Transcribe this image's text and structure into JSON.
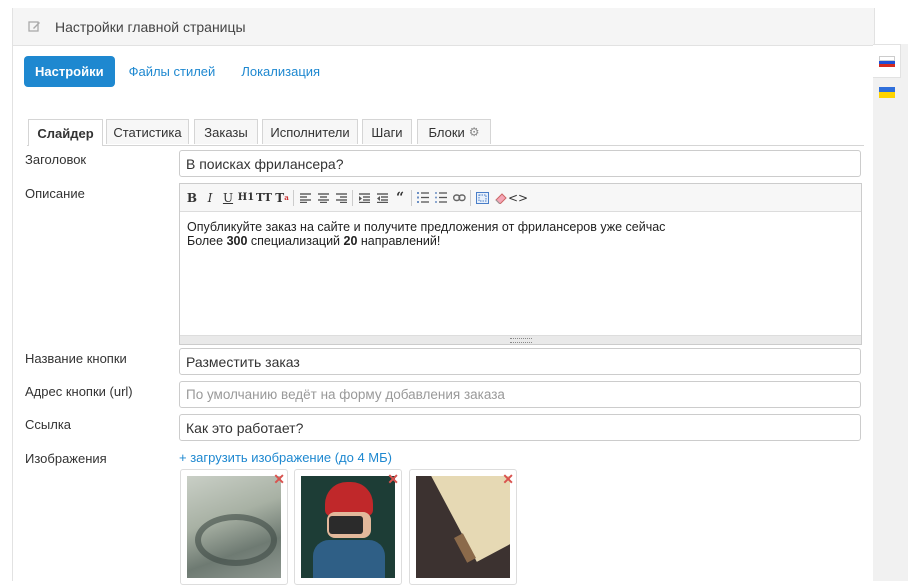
{
  "header": {
    "title": "Настройки главной страницы",
    "icon": "edit-icon"
  },
  "top_tabs": [
    {
      "label": "Настройки",
      "active": true
    },
    {
      "label": "Файлы стилей",
      "active": false
    },
    {
      "label": "Локализация",
      "active": false
    }
  ],
  "languages": [
    {
      "name": "ru",
      "colors": [
        "#ffffff",
        "#1e4fd6",
        "#d52b1e"
      ],
      "active": true
    },
    {
      "name": "ua",
      "colors": [
        "#2f6fdb",
        "#ffd400"
      ],
      "active": false
    }
  ],
  "sub_tabs": [
    {
      "label": "Слайдер",
      "active": true
    },
    {
      "label": "Статистика",
      "active": false
    },
    {
      "label": "Заказы",
      "active": false
    },
    {
      "label": "Исполнители",
      "active": false
    },
    {
      "label": "Шаги",
      "active": false
    },
    {
      "label": "Блоки",
      "active": false,
      "icon": "gear-icon"
    }
  ],
  "form": {
    "title_label": "Заголовок",
    "title_value": "В поисках фрилансера?",
    "description_label": "Описание",
    "description": {
      "line1": "Опубликуйте заказ на сайте и получите предложения от фрилансеров уже сейчас",
      "line2_prefix": "Более ",
      "line2_num1": "300",
      "line2_mid": " специализаций ",
      "line2_num2": "20",
      "line2_suffix": " направлений!"
    },
    "button_name_label": "Название кнопки",
    "button_name_value": "Разместить заказ",
    "button_url_label": "Адрес кнопки (url)",
    "button_url_placeholder": "По умолчанию ведёт на форму добавления заказа",
    "link_label": "Ссылка",
    "link_value": "Как это работает?",
    "images_label": "Изображения",
    "upload_link": "+ загрузить изображение (до 4 МБ)"
  },
  "toolbar_buttons": [
    "B",
    "I",
    "U",
    "H1",
    "TT",
    "T",
    "align-left",
    "align-center",
    "align-right",
    "indent",
    "outdent",
    "quote",
    "ol",
    "ul",
    "link",
    "fullscreen",
    "eraser",
    "code"
  ],
  "images": [
    {
      "name": "map-photo",
      "colors": [
        "#6e7a72",
        "#a8b1a4",
        "#c9cfc6"
      ]
    },
    {
      "name": "camera-girl-photo",
      "colors": [
        "#1d3d36",
        "#c0282a",
        "#2f5f86"
      ]
    },
    {
      "name": "notebook-photo",
      "colors": [
        "#3c3230",
        "#e6d9b4",
        "#b09c76"
      ]
    }
  ]
}
